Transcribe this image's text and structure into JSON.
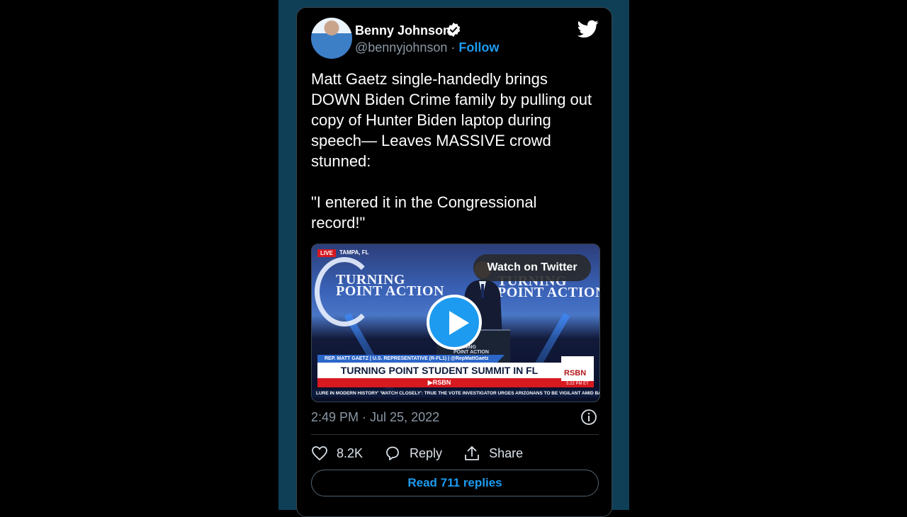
{
  "tweet": {
    "author_name": "Benny Johnson",
    "handle": "@bennyjohnson",
    "separator": "·",
    "follow_label": "Follow",
    "text": "Matt Gaetz single-handedly brings DOWN Biden Crime family by pulling out copy of Hunter Biden laptop during speech— Leaves MASSIVE crowd stunned:\n\n\"I entered it in the Congressional record!\"",
    "timestamp": "2:49 PM · Jul 25, 2022",
    "likes": "8.2K",
    "reply_label": "Reply",
    "share_label": "Share",
    "read_replies_label": "Read 711 replies"
  },
  "video": {
    "watch_label": "Watch on Twitter",
    "live_label": "LIVE",
    "location": "TAMPA, FL",
    "backdrop_left": "TURNING\nPOINT ACTION",
    "backdrop_right": "TURNING\nPOINT ACTION",
    "podium_text": "TURNING\nPOINT ACTION",
    "lower_third_top": "REP. MATT GAETZ | U.S. REPRESENTATIVE (R-FL1) | @RepMattGaetz",
    "lower_third_main": "TURNING POINT STUDENT SUMMIT IN FL",
    "lower_third_brand": "▶RSBN",
    "ticker": "LURE IN MODERN HISTORY'   'WATCH CLOSELY': TRUE THE VOTE INVESTIGATOR URGES ARIZONANS TO BE VIGILANT AMID BALLO",
    "logo_label": "RSBN",
    "logo_time": "5:22 PM ET"
  },
  "icons": {
    "verified": "verified-badge-icon",
    "brand": "twitter-bird-icon",
    "info": "info-icon",
    "like": "heart-icon",
    "reply": "speech-bubble-icon",
    "share": "share-upload-icon",
    "play": "play-icon"
  },
  "colors": {
    "accent": "#1d9bf0",
    "background": "#000000",
    "frame": "#0e3f56",
    "live_red": "#d71920"
  }
}
